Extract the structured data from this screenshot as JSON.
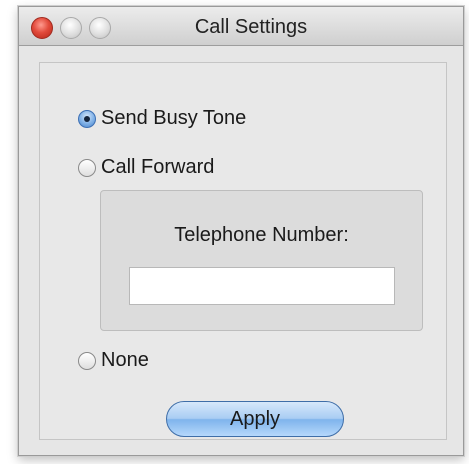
{
  "window": {
    "title": "Call Settings"
  },
  "options": [
    {
      "label": "Send Busy Tone",
      "selected": true
    },
    {
      "label": "Call Forward",
      "selected": false
    },
    {
      "label": "None",
      "selected": false
    }
  ],
  "forward": {
    "label": "Telephone Number:",
    "value": ""
  },
  "apply_label": "Apply",
  "colors": {
    "close": "#e24b3c",
    "accent": "#7fb4ec",
    "window_bg": "#e6e6e6"
  }
}
